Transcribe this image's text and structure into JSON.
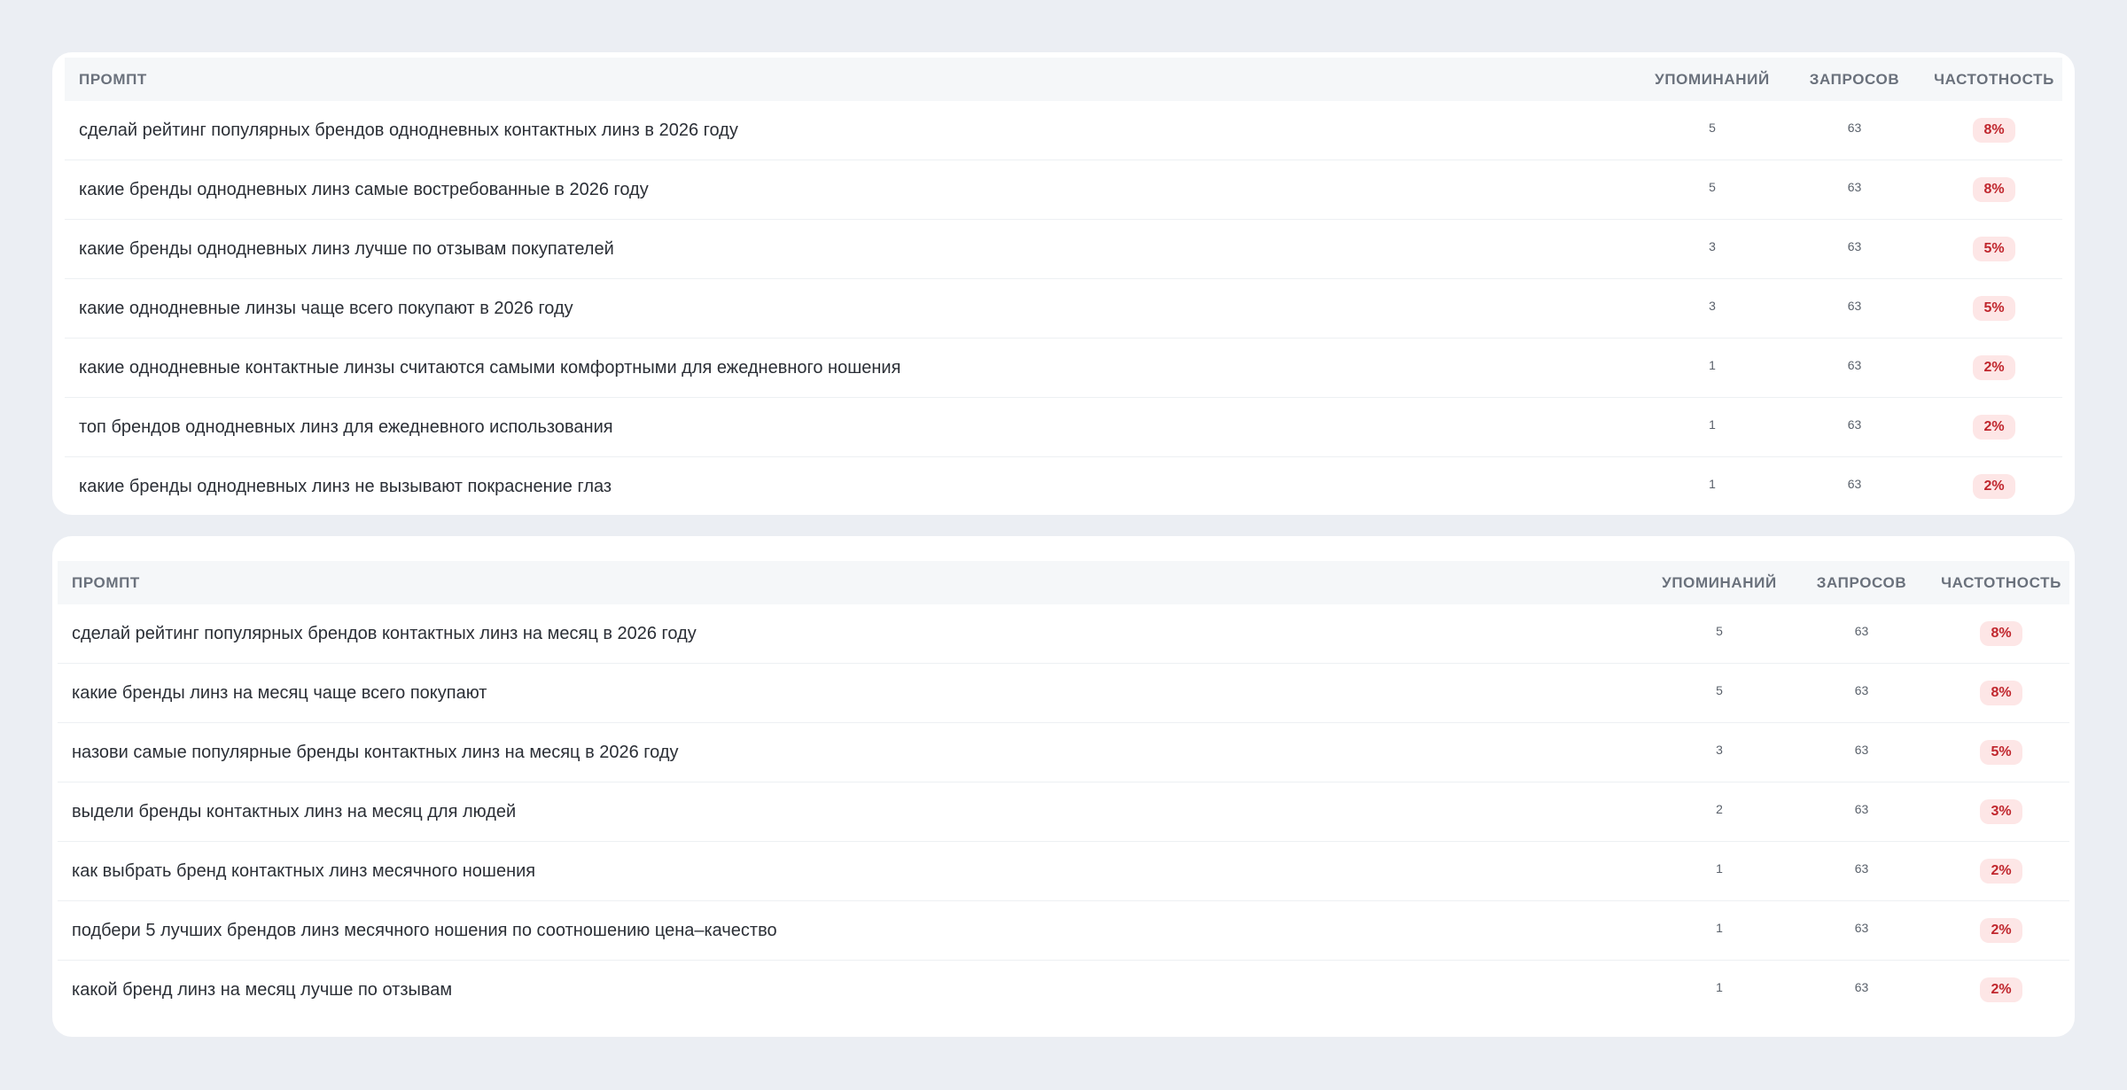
{
  "tables": [
    {
      "headers": {
        "prompt": "ПРОМПТ",
        "mentions": "УПОМИНАНИЙ",
        "queries": "ЗАПРОСОВ",
        "frequency": "ЧАСТОТНОСТЬ"
      },
      "rows": [
        {
          "prompt": "сделай рейтинг популярных брендов однодневных контактных линз в 2026 году",
          "mentions": "5",
          "queries": "63",
          "frequency": "8%"
        },
        {
          "prompt": "какие бренды однодневных линз самые востребованные в 2026 году",
          "mentions": "5",
          "queries": "63",
          "frequency": "8%"
        },
        {
          "prompt": "какие бренды однодневных линз лучше по отзывам покупателей",
          "mentions": "3",
          "queries": "63",
          "frequency": "5%"
        },
        {
          "prompt": "какие однодневные линзы чаще всего покупают в 2026 году",
          "mentions": "3",
          "queries": "63",
          "frequency": "5%"
        },
        {
          "prompt": "какие однодневные контактные линзы считаются самыми комфортными для ежедневного ношения",
          "mentions": "1",
          "queries": "63",
          "frequency": "2%"
        },
        {
          "prompt": "топ брендов однодневных линз для ежедневного использования",
          "mentions": "1",
          "queries": "63",
          "frequency": "2%"
        },
        {
          "prompt": "какие бренды однодневных линз не вызывают покраснение глаз",
          "mentions": "1",
          "queries": "63",
          "frequency": "2%"
        }
      ]
    },
    {
      "headers": {
        "prompt": "ПРОМПТ",
        "mentions": "УПОМИНАНИЙ",
        "queries": "ЗАПРОСОВ",
        "frequency": "ЧАСТОТНОСТЬ"
      },
      "rows": [
        {
          "prompt": "сделай рейтинг популярных брендов контактных линз на месяц в 2026 году",
          "mentions": "5",
          "queries": "63",
          "frequency": "8%"
        },
        {
          "prompt": "какие бренды линз на месяц чаще всего покупают",
          "mentions": "5",
          "queries": "63",
          "frequency": "8%"
        },
        {
          "prompt": "назови самые популярные бренды контактных линз на месяц в 2026 году",
          "mentions": "3",
          "queries": "63",
          "frequency": "5%"
        },
        {
          "prompt": "выдели бренды контактных линз на месяц для людей",
          "mentions": "2",
          "queries": "63",
          "frequency": "3%"
        },
        {
          "prompt": "как выбрать бренд контактных линз месячного ношения",
          "mentions": "1",
          "queries": "63",
          "frequency": "2%"
        },
        {
          "prompt": "подбери 5 лучших брендов линз месячного ношения по соотношению цена–качество",
          "mentions": "1",
          "queries": "63",
          "frequency": "2%"
        },
        {
          "prompt": "какой бренд линз на месяц лучше по отзывам",
          "mentions": "1",
          "queries": "63",
          "frequency": "2%"
        }
      ]
    }
  ],
  "colors": {
    "page_background": "#ebeef3",
    "card_background": "#ffffff",
    "header_background": "#f5f7f9",
    "badge_background": "#fde6e6",
    "badge_text": "#c0262d"
  }
}
